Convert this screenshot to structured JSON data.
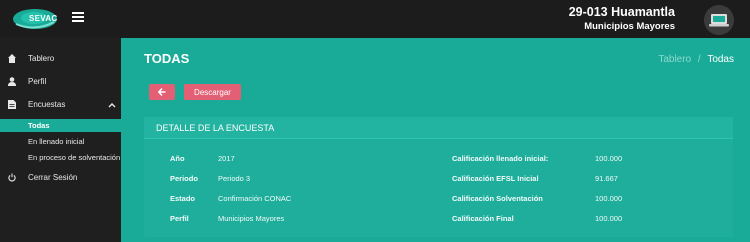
{
  "app": {
    "logo_text": "SEVAC"
  },
  "header": {
    "title": "29-013 Huamantla",
    "subtitle": "Municipios Mayores"
  },
  "sidebar": {
    "items": [
      {
        "label": "Tablero",
        "icon": "home-icon"
      },
      {
        "label": "Perfil",
        "icon": "user-icon"
      },
      {
        "label": "Encuestas",
        "icon": "document-icon"
      },
      {
        "label": "Cerrar Sesión",
        "icon": "power-icon"
      }
    ],
    "subitems": [
      {
        "label": "Todas",
        "active": true
      },
      {
        "label": "En llenado inicial",
        "active": false
      },
      {
        "label": "En proceso de solventación",
        "active": false
      }
    ]
  },
  "page": {
    "title": "TODAS",
    "breadcrumb": {
      "parent": "Tablero",
      "separator": "/",
      "current": "Todas"
    }
  },
  "actions": {
    "download_label": "Descargar"
  },
  "detail": {
    "title": "DETALLE DE LA ENCUESTA",
    "left": [
      {
        "label": "Año",
        "value": "2017"
      },
      {
        "label": "Periodo",
        "value": "Periodo 3"
      },
      {
        "label": "Estado",
        "value": "Confirmación CONAC"
      },
      {
        "label": "Perfil",
        "value": "Municipios Mayores"
      }
    ],
    "right": [
      {
        "label": "Calificación llenado inicial:",
        "value": "100.000"
      },
      {
        "label": "Calificación EFSL Inicial",
        "value": "91.667"
      },
      {
        "label": "Calificación Solventación",
        "value": "100.000"
      },
      {
        "label": "Calificación Final",
        "value": "100.000"
      }
    ]
  },
  "colors": {
    "accent": "#1aab98",
    "topbar": "#1c1c1c",
    "sidebar": "#1f1f1f",
    "button": "#e25f74"
  }
}
